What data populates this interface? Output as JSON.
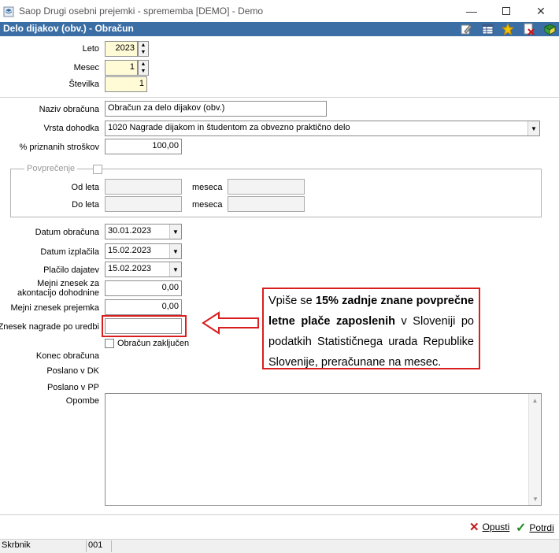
{
  "window": {
    "title": "Saop   Drugi osebni prejemki - sprememba [DEMO] - Demo",
    "minimize_icon": "minimize-icon",
    "maximize_icon": "maximize-icon",
    "close_icon": "close-icon"
  },
  "header": {
    "title": "Delo dijakov (obv.) - Obračun",
    "toolbar_icons": [
      "edit-icon",
      "table-icon",
      "star-icon",
      "delete-icon",
      "book-icon"
    ]
  },
  "form": {
    "leto": {
      "label": "Leto",
      "value": "2023"
    },
    "mesec": {
      "label": "Mesec",
      "value": "1"
    },
    "stevilka": {
      "label": "Številka",
      "value": "1"
    },
    "naziv": {
      "label": "Naziv obračuna",
      "value": "Obračun za delo dijakov (obv.)"
    },
    "vrsta": {
      "label": "Vrsta dohodka",
      "value": "1020  Nagrade dijakom in študentom za obvezno praktično delo"
    },
    "stroski": {
      "label": "% priznanih stroškov",
      "value": "100,00"
    },
    "povprecenje": {
      "label": "Povprečenje",
      "od_leta": "Od leta",
      "do_leta": "Do leta",
      "meseca1": "meseca",
      "meseca2": "meseca"
    },
    "datum_obracuna": {
      "label": "Datum obračuna",
      "value": "30.01.2023"
    },
    "datum_izplacila": {
      "label": "Datum izplačila",
      "value": "15.02.2023"
    },
    "placilo_dajatev": {
      "label": "Plačilo dajatev",
      "value": "15.02.2023"
    },
    "mejni_akontacija": {
      "label_line1": "Mejni znesek za",
      "label_line2": "akontacijo dohodnine",
      "value": "0,00"
    },
    "mejni_prejemka": {
      "label": "Mejni znesek prejemka",
      "value": "0,00"
    },
    "znesek_nagrade": {
      "label": "Znesek nagrade po uredbi",
      "value": ""
    },
    "obracun_zakljucen": {
      "label": "Obračun zaključen",
      "checked": false
    },
    "konec_obracuna": {
      "label": "Konec obračuna"
    },
    "poslano_dk": {
      "label": "Poslano v DK"
    },
    "poslano_pp": {
      "label": "Poslano v PP"
    },
    "opombe": {
      "label": "Opombe",
      "value": ""
    }
  },
  "callout": {
    "text_pre": "Vpiše se ",
    "text_bold": "15% zadnje znane povprečne letne plače zaposlenih",
    "text_post": " v Sloveniji po podatkih Statističnega urada Republike Slovenije, preračunane na mesec.",
    "border_color": "#d81e1e"
  },
  "footer": {
    "cancel_label": "Opusti",
    "confirm_label": "Potrdi"
  },
  "statusbar": {
    "user": "Skrbnik",
    "code": "001"
  },
  "colors": {
    "header_bg": "#3a6ea5",
    "required_field_bg": "#fffbd6"
  }
}
